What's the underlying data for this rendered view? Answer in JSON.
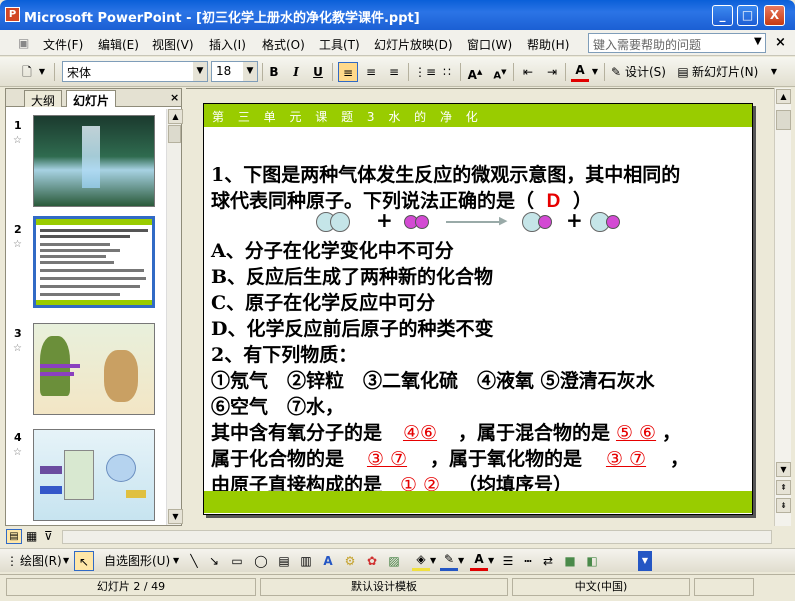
{
  "window": {
    "title": "Microsoft PowerPoint - [初三化学上册水的净化教学课件.ppt]",
    "app_icon": "P",
    "minimize": "_",
    "maximize": "□",
    "close": "X"
  },
  "menu": {
    "items": [
      "文件(F)",
      "编辑(E)",
      "视图(V)",
      "插入(I)",
      "格式(O)",
      "工具(T)",
      "幻灯片放映(D)",
      "窗口(W)",
      "帮助(H)"
    ],
    "help_placeholder": "键入需要帮助的问题"
  },
  "toolbar": {
    "font": "宋体",
    "size": "18",
    "bold": "B",
    "italic": "I",
    "underline": "U",
    "font_color": "A",
    "design": "设计(S)",
    "new_slide": "新幻灯片(N)"
  },
  "panel": {
    "tabs": [
      "大纲",
      "幻灯片"
    ],
    "thumbs": [
      "1",
      "2",
      "3",
      "4"
    ]
  },
  "slide": {
    "header": "第 三 单 元 课 题 3 水 的 净 化",
    "q1_line1": "1、下图是两种气体发生反应的微观示意图，其中相同的",
    "q1_line2_prefix": "球代表同种原子。下列说法正确的是（",
    "q1_answer": "D",
    "q1_line2_suffix": "）",
    "plus": "+",
    "optA": "A、分子在化学变化中不可分",
    "optB": "B、反应后生成了两种新的化合物",
    "optC": "C、原子在化学反应中可分",
    "optD": "D、化学反应前后原子的种类不变",
    "q2_title": "2、有下列物质：",
    "q2_items1": "①氖气　②锌粒　③二氧化硫　④液氧 ⑤澄清石灰水",
    "q2_items2": "⑥空气　⑦水，",
    "q2_l1_a": "其中含有氧分子的是",
    "q2_l1_ans1": "④⑥",
    "q2_l1_b": "，属于混合物的是",
    "q2_l1_ans2": "⑤ ⑥",
    "q2_l1_c": "，",
    "q2_l2_a": "属于化合物的是",
    "q2_l2_ans1": "③ ⑦",
    "q2_l2_b": "，属于氧化物的是",
    "q2_l2_ans2": "③ ⑦",
    "q2_l2_c": "，",
    "q2_l3_a": "由原子直接构成的是",
    "q2_l3_ans": "① ②",
    "q2_l3_b": "（均填序号）"
  },
  "drawbar": {
    "draw": "绘图(R)",
    "autoshape": "自选图形(U)"
  },
  "status": {
    "slide": "幻灯片 2 / 49",
    "template": "默认设计模板",
    "lang": "中文(中国)"
  },
  "colors": {
    "accent_green": "#99cc00",
    "answer_red": "#e60000",
    "title_blue": "#0a5fd8",
    "selection_blue": "#316ac5"
  }
}
